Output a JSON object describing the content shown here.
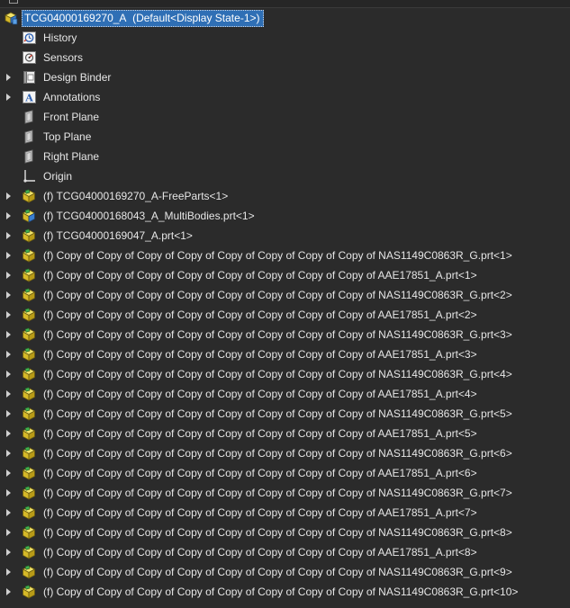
{
  "root": {
    "name": "TCG04000169270_A",
    "state": "(Default<Display State-1>)"
  },
  "features": [
    {
      "label": "History",
      "icon": "history-icon",
      "expandable": false
    },
    {
      "label": "Sensors",
      "icon": "sensor-icon",
      "expandable": false
    },
    {
      "label": "Design Binder",
      "icon": "design-binder-icon",
      "expandable": true
    },
    {
      "label": "Annotations",
      "icon": "annotations-icon",
      "expandable": true
    },
    {
      "label": "Front Plane",
      "icon": "plane-icon",
      "expandable": false
    },
    {
      "label": "Top Plane",
      "icon": "plane-icon",
      "expandable": false
    },
    {
      "label": "Right Plane",
      "icon": "plane-icon",
      "expandable": false
    },
    {
      "label": "Origin",
      "icon": "origin-icon",
      "expandable": false
    }
  ],
  "components": [
    {
      "label": "(f) TCG04000169270_A-FreeParts<1>",
      "icon": "part-icon"
    },
    {
      "label": "(f) TCG04000168043_A_MultiBodies.prt<1>",
      "icon": "multibody-part-icon"
    },
    {
      "label": "(f) TCG04000169047_A.prt<1>",
      "icon": "part-icon"
    },
    {
      "label": "(f) Copy of Copy of Copy of Copy of Copy of Copy of Copy of Copy of NAS1149C0863R_G.prt<1>",
      "icon": "part-icon"
    },
    {
      "label": "(f) Copy of Copy of Copy of Copy of Copy of Copy of Copy of Copy of AAE17851_A.prt<1>",
      "icon": "part-icon"
    },
    {
      "label": "(f) Copy of Copy of Copy of Copy of Copy of Copy of Copy of Copy of NAS1149C0863R_G.prt<2>",
      "icon": "part-icon"
    },
    {
      "label": "(f) Copy of Copy of Copy of Copy of Copy of Copy of Copy of Copy of AAE17851_A.prt<2>",
      "icon": "part-icon"
    },
    {
      "label": "(f) Copy of Copy of Copy of Copy of Copy of Copy of Copy of Copy of NAS1149C0863R_G.prt<3>",
      "icon": "part-icon"
    },
    {
      "label": "(f) Copy of Copy of Copy of Copy of Copy of Copy of Copy of Copy of AAE17851_A.prt<3>",
      "icon": "part-icon"
    },
    {
      "label": "(f) Copy of Copy of Copy of Copy of Copy of Copy of Copy of Copy of NAS1149C0863R_G.prt<4>",
      "icon": "part-icon"
    },
    {
      "label": "(f) Copy of Copy of Copy of Copy of Copy of Copy of Copy of Copy of AAE17851_A.prt<4>",
      "icon": "part-icon"
    },
    {
      "label": "(f) Copy of Copy of Copy of Copy of Copy of Copy of Copy of Copy of NAS1149C0863R_G.prt<5>",
      "icon": "part-icon"
    },
    {
      "label": "(f) Copy of Copy of Copy of Copy of Copy of Copy of Copy of Copy of AAE17851_A.prt<5>",
      "icon": "part-icon"
    },
    {
      "label": "(f) Copy of Copy of Copy of Copy of Copy of Copy of Copy of Copy of NAS1149C0863R_G.prt<6>",
      "icon": "part-icon"
    },
    {
      "label": "(f) Copy of Copy of Copy of Copy of Copy of Copy of Copy of Copy of AAE17851_A.prt<6>",
      "icon": "part-icon"
    },
    {
      "label": "(f) Copy of Copy of Copy of Copy of Copy of Copy of Copy of Copy of NAS1149C0863R_G.prt<7>",
      "icon": "part-icon"
    },
    {
      "label": "(f) Copy of Copy of Copy of Copy of Copy of Copy of Copy of Copy of AAE17851_A.prt<7>",
      "icon": "part-icon"
    },
    {
      "label": "(f) Copy of Copy of Copy of Copy of Copy of Copy of Copy of Copy of NAS1149C0863R_G.prt<8>",
      "icon": "part-icon"
    },
    {
      "label": "(f) Copy of Copy of Copy of Copy of Copy of Copy of Copy of Copy of AAE17851_A.prt<8>",
      "icon": "part-icon"
    },
    {
      "label": "(f) Copy of Copy of Copy of Copy of Copy of Copy of Copy of Copy of NAS1149C0863R_G.prt<9>",
      "icon": "part-icon"
    },
    {
      "label": "(f) Copy of Copy of Copy of Copy of Copy of Copy of Copy of Copy of NAS1149C0863R_G.prt<10>",
      "icon": "part-icon"
    }
  ],
  "colors": {
    "background": "#2b2b2b",
    "selection": "#2f6fb5",
    "text": "#e6e6e6",
    "part_yellow": "#e8d23a",
    "part_green": "#3ea84a"
  }
}
